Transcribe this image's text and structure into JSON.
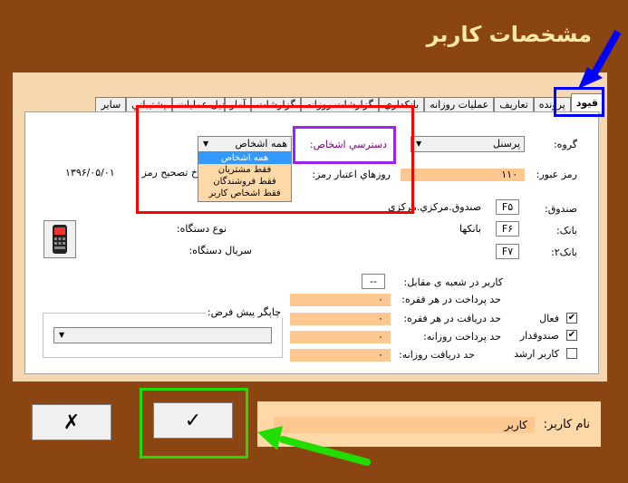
{
  "title": "مشخصات کاربر",
  "tabs": [
    "قيود",
    "پرونده",
    "تعاريف",
    "عمليات روزانه",
    "بانکداري",
    "گزارشات روزانه",
    "گزارشات",
    "آمار",
    "تبديل عمليات",
    "پشتيباني",
    "ساير"
  ],
  "active_tab": 0,
  "form": {
    "group_label": "گروه:",
    "group_value": "پرسنل",
    "access_label": "دسترسي اشخاص:",
    "access_value": "همه اشخاص",
    "access_options": [
      "همه اشخاص",
      "فقط مشتريان",
      "فقط فروشندگان",
      "فقط اشخاص کاربر"
    ],
    "password_label": "رمز عبور:",
    "password_value": "۱۱۰",
    "validity_label": "روزهاي اعتبار رمز:",
    "fix_date_label": "خ تصحيح رمز",
    "date_value": "۱۳۹۶/۰۵/۰۱",
    "fund_label": "صندوق:",
    "fund_code": "F۵",
    "fund_value": "صندوق.مرکزي.مرکزي",
    "bank_label": "بانک:",
    "bank_code": "F۶",
    "bank_value": "بانکها",
    "bank2_label": "بانک۲:",
    "bank2_code": "F۷",
    "device_type_label": "نوع دستگاه:",
    "device_serial_label": "سريال دستگاه:",
    "branch_user_label": "کاربر در شعبه ی مقابل:",
    "branch_user_value": "--",
    "max_pay_item_label": "حد پرداخت در هر فقره:",
    "max_pay_item_value": "۰",
    "max_recv_item_label": "حد دريافت در هر فقره:",
    "max_recv_item_value": "۰",
    "max_pay_day_label": "حد پرداخت روزانه:",
    "max_pay_day_value": "۰",
    "max_recv_day_label": "حد دريافت روزانه:",
    "max_recv_day_value": "۰",
    "active_label": "فعال",
    "active_checked": true,
    "cashier_label": "صندوقدار",
    "cashier_checked": true,
    "senior_label": "کاربر ارشد",
    "senior_checked": false,
    "default_printer_label": "چاپگر پيش فرض:",
    "default_printer_value": ""
  },
  "username_label": "نام کاربر:",
  "username_value": "کاربر",
  "ok_glyph": "✓",
  "cancel_glyph": "✗",
  "colors": {
    "background": "#8B4513",
    "field": "#FFC890",
    "selected": "#3399FF"
  },
  "icons": {
    "pos_device": "pos-terminal-icon"
  }
}
